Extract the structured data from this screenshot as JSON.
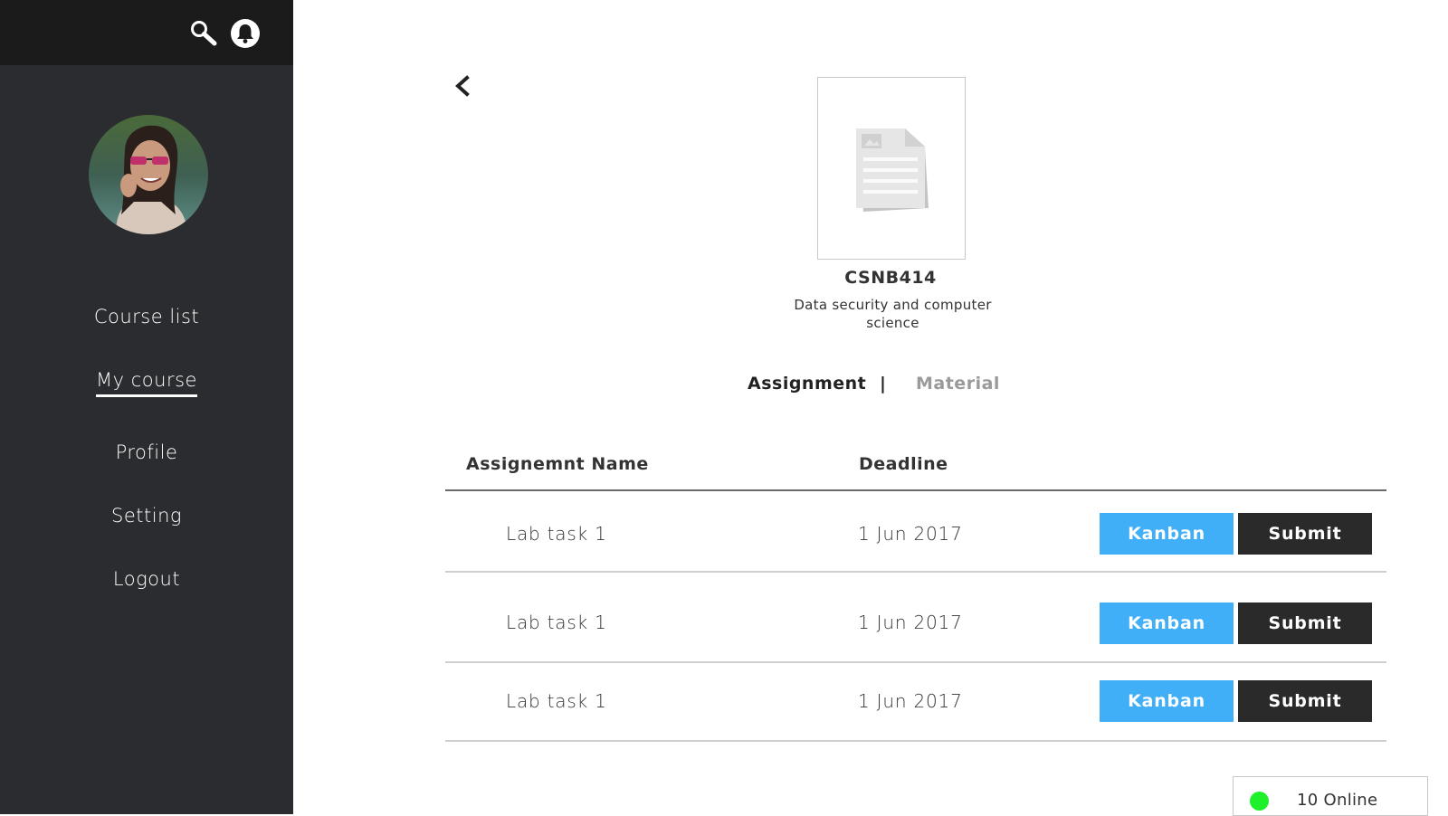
{
  "topbar": {
    "search_icon": "search-icon",
    "notification_icon": "bell-icon"
  },
  "sidebar": {
    "items": [
      {
        "label": "Course list",
        "active": false
      },
      {
        "label": "My course",
        "active": true
      },
      {
        "label": "Profile",
        "active": false
      },
      {
        "label": "Setting",
        "active": false
      },
      {
        "label": "Logout",
        "active": false
      }
    ]
  },
  "course": {
    "code": "CSNB414",
    "description": "Data security and computer science"
  },
  "tabs": {
    "assignment": "Assignment",
    "separator": "|",
    "material": "Material"
  },
  "table": {
    "headers": {
      "name": "Assignemnt Name",
      "deadline": "Deadline"
    },
    "rows": [
      {
        "name": "Lab task 1",
        "deadline": "1 Jun 2017",
        "kanban": "Kanban",
        "submit": "Submit"
      },
      {
        "name": "Lab task 1",
        "deadline": "1 Jun 2017",
        "kanban": "Kanban",
        "submit": "Submit"
      },
      {
        "name": "Lab task 1",
        "deadline": "1 Jun 2017",
        "kanban": "Kanban",
        "submit": "Submit"
      }
    ]
  },
  "status": {
    "online_label": "10 Online",
    "online_color": "#1ef02b"
  },
  "colors": {
    "sidebar": "#2b2c2f",
    "topbar": "#1b1b1b",
    "kanban": "#41aff7",
    "submit": "#2a2a2a"
  }
}
